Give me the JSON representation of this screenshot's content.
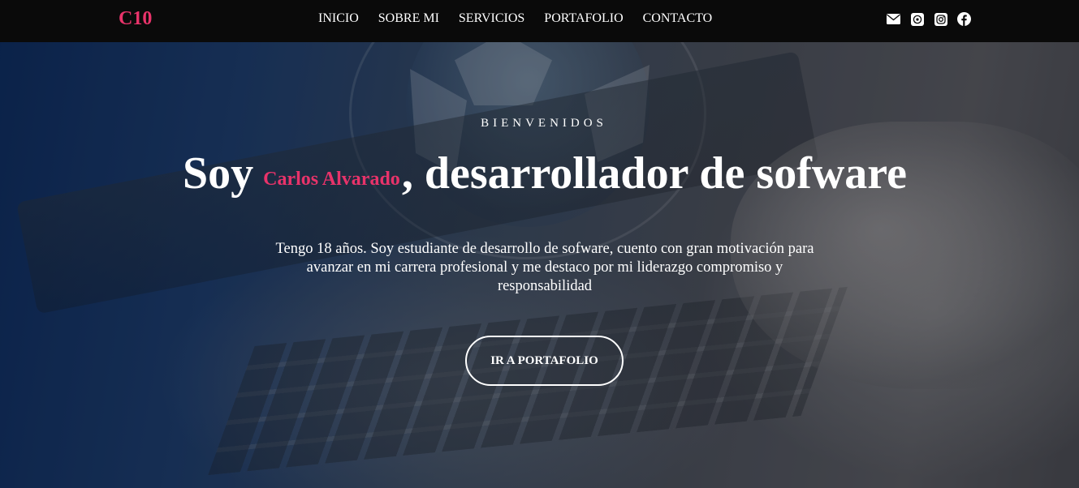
{
  "navbar": {
    "brand": "C10",
    "links": [
      {
        "label": "INICIO"
      },
      {
        "label": "SOBRE MI"
      },
      {
        "label": "SERVICIOS"
      },
      {
        "label": "PORTAFOLIO"
      },
      {
        "label": "CONTACTO"
      }
    ],
    "social_icons": [
      "envelope-icon",
      "whatsapp-icon",
      "instagram-icon",
      "facebook-icon"
    ]
  },
  "hero": {
    "eyebrow": "BIENVENIDOS",
    "headline_prefix": "Soy",
    "headline_name": "Carlos Alvarado",
    "headline_suffix": ", desarrollador de sofware",
    "bio": "Tengo 18 años. Soy estudiante de desarrollo de sofware, cuento con gran motivación para avanzar en mi carrera profesional y me destaco por mi liderazgo compromiso y responsabilidad",
    "cta_label": "IR A PORTAFOLIO"
  },
  "colors": {
    "accent": "#e8336a",
    "navbar_bg": "#0a0a0a",
    "text": "#ffffff"
  }
}
